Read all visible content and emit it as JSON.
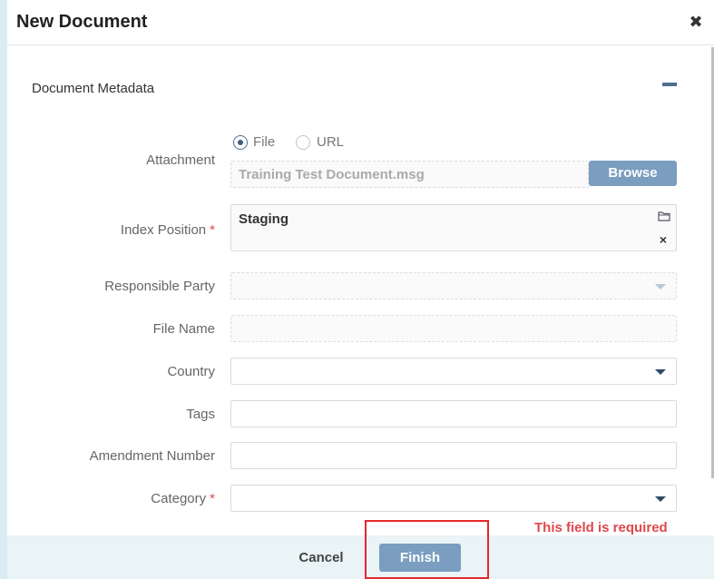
{
  "dialog": {
    "title": "New Document",
    "close_icon": "close-icon"
  },
  "section": {
    "title": "Document Metadata",
    "collapse_icon": "minus-icon"
  },
  "attachment": {
    "label": "Attachment",
    "options": [
      "File",
      "URL"
    ],
    "selected": "File",
    "file_value": "Training Test Document.msg",
    "browse_label": "Browse"
  },
  "index_position": {
    "label": "Index Position",
    "required": "*",
    "value": "Staging",
    "folder_icon": "folder-icon",
    "clear_icon": "clear-icon",
    "clear_glyph": "×"
  },
  "responsible_party": {
    "label": "Responsible Party",
    "value": ""
  },
  "file_name": {
    "label": "File Name",
    "value": ""
  },
  "country": {
    "label": "Country",
    "value": ""
  },
  "tags": {
    "label": "Tags",
    "value": ""
  },
  "amendment_number": {
    "label": "Amendment Number",
    "value": ""
  },
  "category": {
    "label": "Category",
    "required": "*",
    "value": "",
    "error": "This field is required"
  },
  "footer": {
    "cancel_label": "Cancel",
    "finish_label": "Finish"
  },
  "colors": {
    "accent": "#7a9dc0",
    "error": "#e0474c",
    "highlight": "#e5262d",
    "page_bg": "#d9ecf2"
  }
}
